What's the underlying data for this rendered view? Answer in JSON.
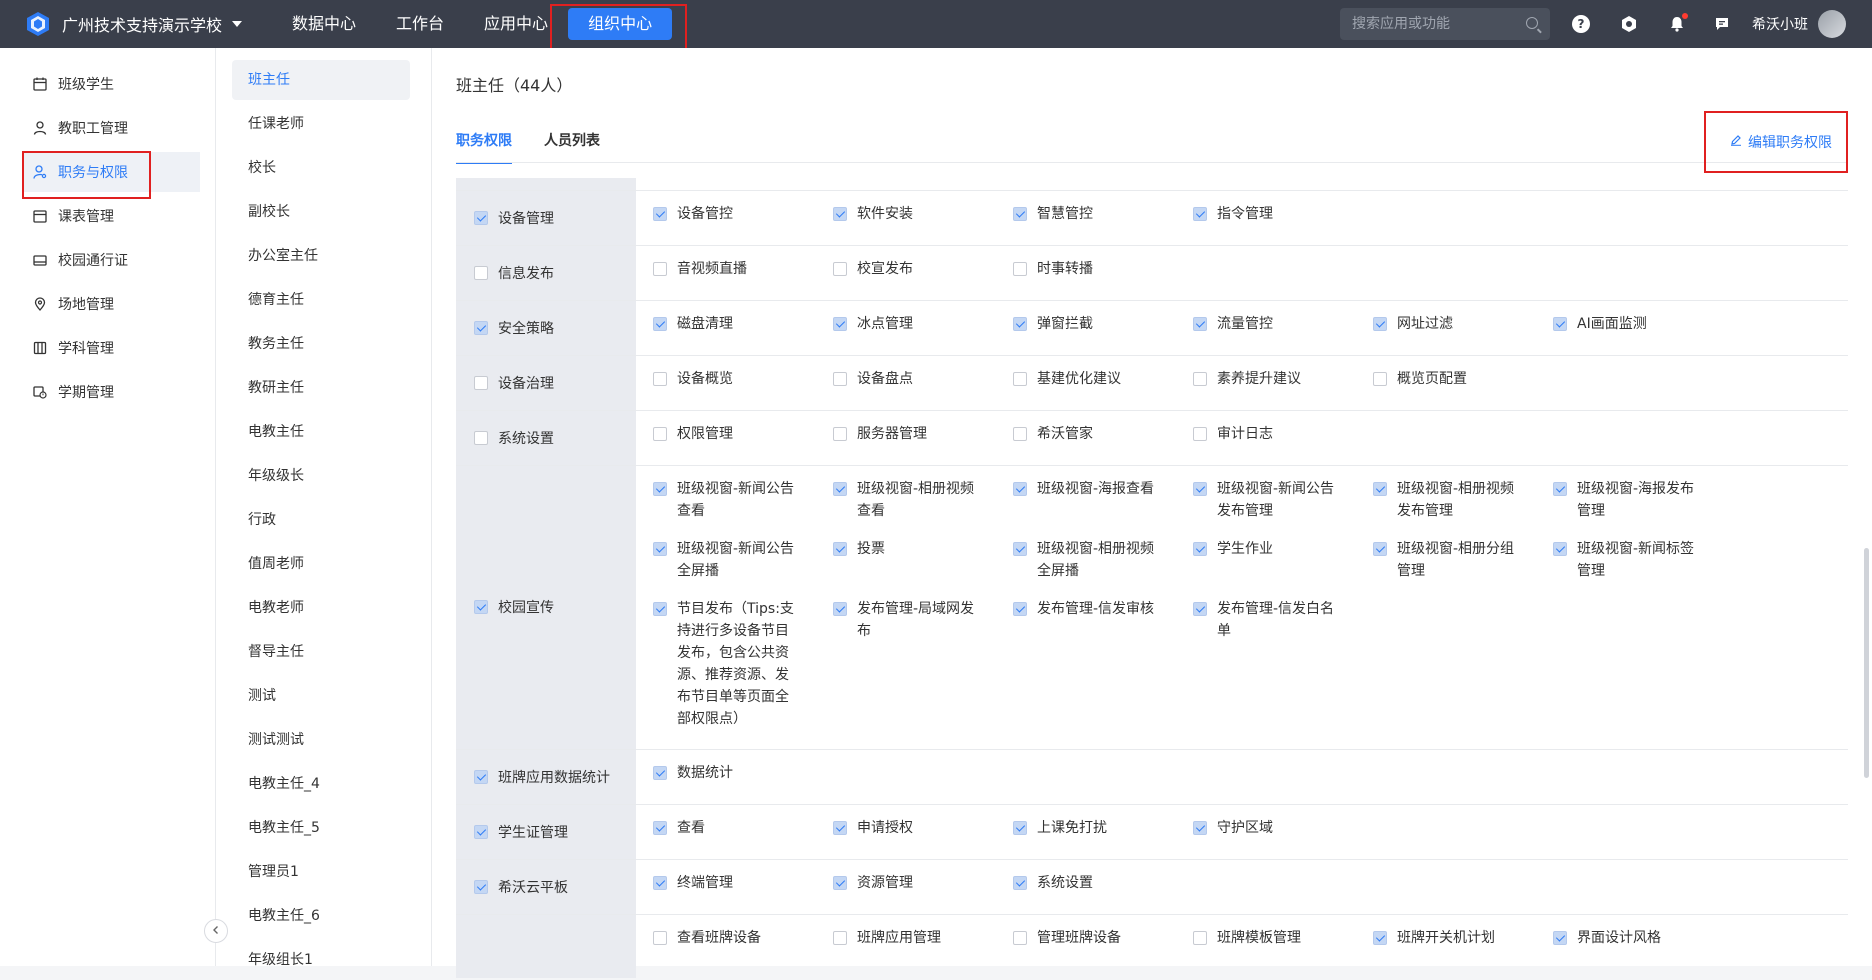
{
  "topbar": {
    "school": "广州技术支持演示学校",
    "nav": [
      "数据中心",
      "工作台",
      "应用中心",
      "组织中心"
    ],
    "active_nav": 3,
    "search_placeholder": "搜索应用或功能",
    "username": "希沃小班",
    "help_glyph": "?"
  },
  "sidebar": {
    "items": [
      "班级学生",
      "教职工管理",
      "职务与权限",
      "课表管理",
      "校园通行证",
      "场地管理",
      "学科管理",
      "学期管理"
    ],
    "icons": [
      "calendar-icon",
      "person-icon",
      "person-key-icon",
      "calendar-icon",
      "card-icon",
      "location-icon",
      "book-icon",
      "calendar-clock-icon"
    ],
    "active": 2
  },
  "roles": {
    "items": [
      "班主任",
      "任课老师",
      "校长",
      "副校长",
      "办公室主任",
      "德育主任",
      "教务主任",
      "教研主任",
      "电教主任",
      "年级级长",
      "行政",
      "值周老师",
      "电教老师",
      "督导主任",
      "测试",
      "测试测试",
      "电教主任_4",
      "电教主任_5",
      "管理员1",
      "电教主任_6",
      "年级组长1"
    ],
    "active": 0
  },
  "main": {
    "title": "班主任（44人）",
    "tabs": [
      "职务权限",
      "人员列表"
    ],
    "active_tab": 0,
    "edit_label": "编辑职务权限"
  },
  "accent_color": "#2e7cf6",
  "permissions": [
    {
      "category": "设备管理",
      "checked": true,
      "items": [
        {
          "label": "设备管控",
          "checked": true
        },
        {
          "label": "软件安装",
          "checked": true
        },
        {
          "label": "智慧管控",
          "checked": true
        },
        {
          "label": "指令管理",
          "checked": true
        }
      ]
    },
    {
      "category": "信息发布",
      "checked": false,
      "items": [
        {
          "label": "音视频直播",
          "checked": false
        },
        {
          "label": "校宣发布",
          "checked": false
        },
        {
          "label": "时事转播",
          "checked": false
        }
      ]
    },
    {
      "category": "安全策略",
      "checked": true,
      "items": [
        {
          "label": "磁盘清理",
          "checked": true
        },
        {
          "label": "冰点管理",
          "checked": true
        },
        {
          "label": "弹窗拦截",
          "checked": true
        },
        {
          "label": "流量管控",
          "checked": true
        },
        {
          "label": "网址过滤",
          "checked": true
        },
        {
          "label": "AI画面监测",
          "checked": true
        }
      ]
    },
    {
      "category": "设备治理",
      "checked": false,
      "items": [
        {
          "label": "设备概览",
          "checked": false
        },
        {
          "label": "设备盘点",
          "checked": false
        },
        {
          "label": "基建优化建议",
          "checked": false
        },
        {
          "label": "素养提升建议",
          "checked": false
        },
        {
          "label": "概览页配置",
          "checked": false
        }
      ]
    },
    {
      "category": "系统设置",
      "checked": false,
      "items": [
        {
          "label": "权限管理",
          "checked": false
        },
        {
          "label": "服务器管理",
          "checked": false
        },
        {
          "label": "希沃管家",
          "checked": false
        },
        {
          "label": "审计日志",
          "checked": false
        }
      ]
    },
    {
      "category": "校园宣传",
      "checked": true,
      "items": [
        {
          "label": "班级视窗-新闻公告查看",
          "checked": true
        },
        {
          "label": "班级视窗-相册视频查看",
          "checked": true
        },
        {
          "label": "班级视窗-海报查看",
          "checked": true
        },
        {
          "label": "班级视窗-新闻公告发布管理",
          "checked": true
        },
        {
          "label": "班级视窗-相册视频发布管理",
          "checked": true
        },
        {
          "label": "班级视窗-海报发布管理",
          "checked": true
        },
        {
          "label": "班级视窗-新闻公告全屏播",
          "checked": true
        },
        {
          "label": "投票",
          "checked": true
        },
        {
          "label": "班级视窗-相册视频全屏播",
          "checked": true
        },
        {
          "label": "学生作业",
          "checked": true
        },
        {
          "label": "班级视窗-相册分组管理",
          "checked": true
        },
        {
          "label": "班级视窗-新闻标签管理",
          "checked": true
        },
        {
          "label": "节目发布（Tips:支持进行多设备节目发布，包含公共资源、推荐资源、发布节目单等页面全部权限点）",
          "checked": true
        },
        {
          "label": "发布管理-局域网发布",
          "checked": true
        },
        {
          "label": "发布管理-信发审核",
          "checked": true
        },
        {
          "label": "发布管理-信发白名单",
          "checked": true
        }
      ]
    },
    {
      "category": "班牌应用数据统计",
      "checked": true,
      "items": [
        {
          "label": "数据统计",
          "checked": true
        }
      ]
    },
    {
      "category": "学生证管理",
      "checked": true,
      "items": [
        {
          "label": "查看",
          "checked": true
        },
        {
          "label": "申请授权",
          "checked": true
        },
        {
          "label": "上课免打扰",
          "checked": true
        },
        {
          "label": "守护区域",
          "checked": true
        }
      ]
    },
    {
      "category": "希沃云平板",
      "checked": true,
      "items": [
        {
          "label": "终端管理",
          "checked": true
        },
        {
          "label": "资源管理",
          "checked": true
        },
        {
          "label": "系统设置",
          "checked": true
        }
      ]
    },
    {
      "category": "",
      "checked": false,
      "items": [
        {
          "label": "查看班牌设备",
          "checked": false
        },
        {
          "label": "班牌应用管理",
          "checked": false
        },
        {
          "label": "管理班牌设备",
          "checked": false
        },
        {
          "label": "班牌模板管理",
          "checked": false
        },
        {
          "label": "班牌开关机计划",
          "checked": true
        },
        {
          "label": "界面设计风格",
          "checked": true
        }
      ]
    }
  ]
}
